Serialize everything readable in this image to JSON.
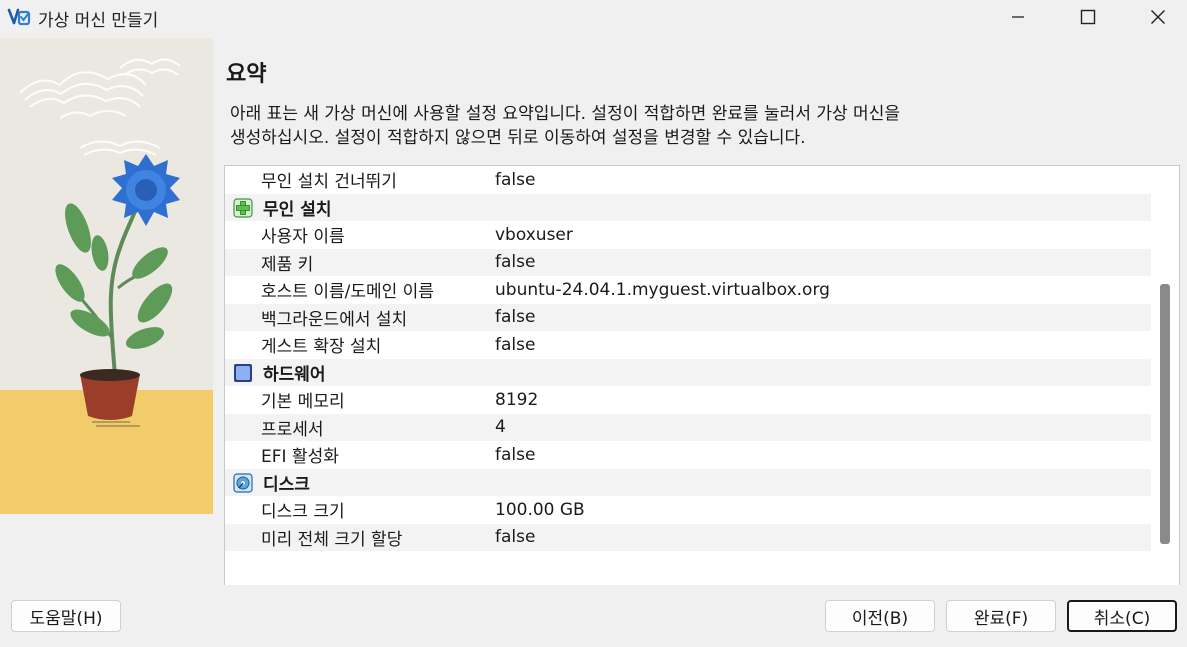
{
  "window": {
    "title": "가상 머신 만들기",
    "icons": {
      "app": "virtualbox-icon",
      "minimize": "minimize-icon",
      "maximize": "maximize-icon",
      "close": "close-icon"
    }
  },
  "page": {
    "title": "요약",
    "description_line1": "아래 표는 새 가상 머신에 사용할 설정 요약입니다. 설정이 적합하면 완료를 눌러서 가상 머신을",
    "description_line2": "생성하십시오. 설정이 적합하지 않으면 뒤로 이동하여 설정을 변경할 수 있습니다."
  },
  "summary": {
    "rows": [
      {
        "kind": "item",
        "key": "무인 설치 건너뛰기",
        "value": "false"
      },
      {
        "kind": "section",
        "key": "무인 설치",
        "icon": "unattended-install-icon"
      },
      {
        "kind": "item",
        "key": "사용자 이름",
        "value": "vboxuser"
      },
      {
        "kind": "item",
        "key": "제품 키",
        "value": "false"
      },
      {
        "kind": "item",
        "key": "호스트 이름/도메인 이름",
        "value": "ubuntu-24.04.1.myguest.virtualbox.org"
      },
      {
        "kind": "item",
        "key": "백그라운드에서 설치",
        "value": "false"
      },
      {
        "kind": "item",
        "key": "게스트 확장 설치",
        "value": "false"
      },
      {
        "kind": "section",
        "key": "하드웨어",
        "icon": "hardware-chip-icon"
      },
      {
        "kind": "item",
        "key": "기본 메모리",
        "value": "8192"
      },
      {
        "kind": "item",
        "key": "프로세서",
        "value": "4"
      },
      {
        "kind": "item",
        "key": "EFI 활성화",
        "value": "false"
      },
      {
        "kind": "section",
        "key": "디스크",
        "icon": "disk-icon"
      },
      {
        "kind": "item",
        "key": "디스크 크기",
        "value": "100.00 GB"
      },
      {
        "kind": "item",
        "key": "미리 전체 크기 할당",
        "value": "false"
      }
    ]
  },
  "buttons": {
    "help": "도움말(H)",
    "back": "이전(B)",
    "finish": "완료(F)",
    "cancel": "취소(C)"
  },
  "colors": {
    "section_icon_green": "#5cc04a",
    "section_icon_blue": "#6d8fe0",
    "scrollbar": "#8a8a8a"
  }
}
